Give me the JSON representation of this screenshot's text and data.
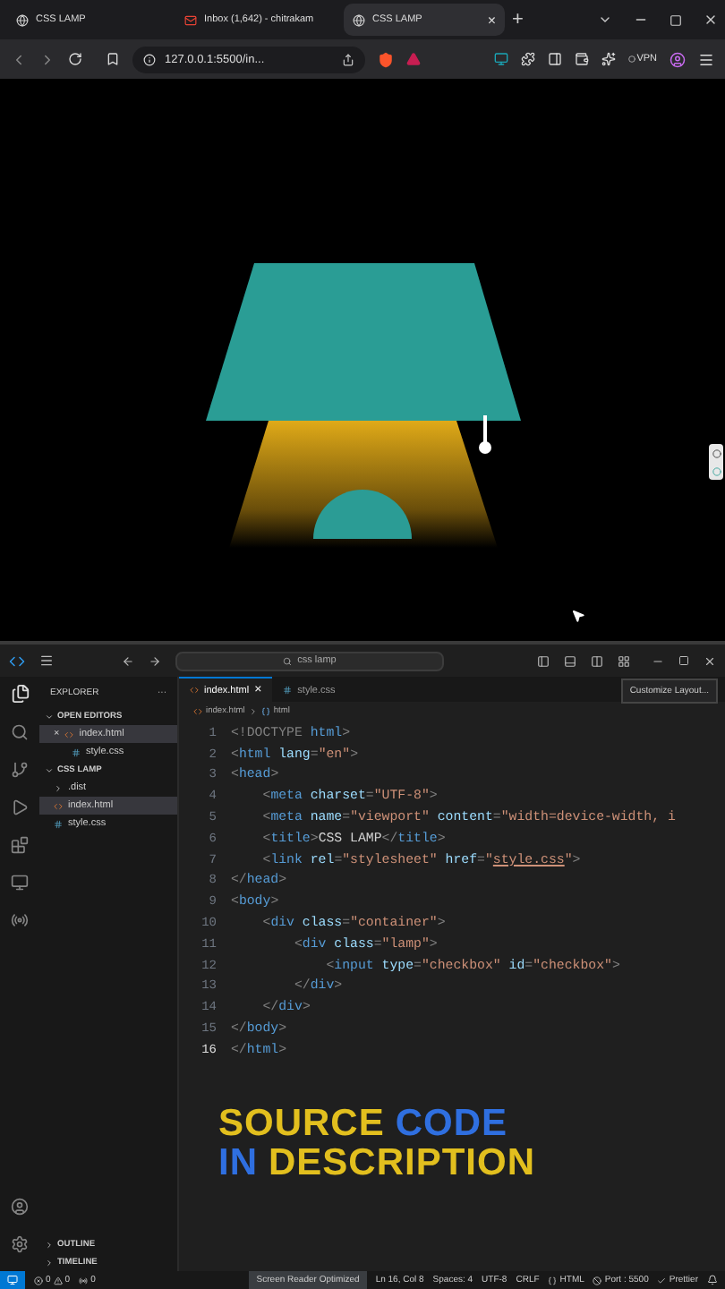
{
  "browser": {
    "tabs": [
      {
        "title": "CSS LAMP",
        "kind": "globe",
        "selected": false
      },
      {
        "title": "Inbox (1,642) - chitrakam",
        "kind": "mail",
        "selected": false
      },
      {
        "title": "CSS LAMP",
        "kind": "globe",
        "selected": true,
        "close": "×"
      }
    ],
    "new_tab": "+",
    "url": "127.0.0.1:5500/in...",
    "vpn": "VPN"
  },
  "page": {
    "lamp": {
      "on": true
    }
  },
  "editor": {
    "search": "css lamp",
    "tooltip": "Customize Layout...",
    "explorer": {
      "title": "EXPLORER",
      "more": "···",
      "sections": [
        {
          "title": "OPEN EDITORS",
          "expanded": true,
          "items": [
            {
              "name": "index.html",
              "kind": "html",
              "selected": true,
              "close": "×"
            },
            {
              "name": "style.css",
              "kind": "css",
              "selected": false
            }
          ]
        },
        {
          "title": "CSS LAMP",
          "expanded": true,
          "items": [
            {
              "name": ".dist",
              "kind": "folder",
              "selected": false
            },
            {
              "name": "index.html",
              "kind": "html",
              "selected": true
            },
            {
              "name": "style.css",
              "kind": "css",
              "selected": false
            }
          ]
        }
      ],
      "bottom_sections": [
        {
          "title": "OUTLINE",
          "expanded": false
        },
        {
          "title": "TIMELINE",
          "expanded": false
        }
      ]
    },
    "tabs": [
      {
        "name": "index.html",
        "kind": "html",
        "selected": true,
        "close": "×"
      },
      {
        "name": "style.css",
        "kind": "css",
        "selected": false
      }
    ],
    "breadcrumb": [
      "index.html",
      "html"
    ],
    "lines": [
      {
        "number": "1",
        "current": false,
        "tokens": [
          {
            "kind": "p",
            "t": "<!DOCTYPE"
          },
          {
            "kind": "tag",
            "t": " html"
          },
          {
            "kind": "p",
            "t": ">"
          }
        ]
      },
      {
        "number": "2",
        "current": false,
        "tokens": [
          {
            "kind": "p",
            "t": "<"
          },
          {
            "kind": "tag",
            "t": "html"
          },
          {
            "kind": "attr",
            "t": " lang"
          },
          {
            "kind": "p",
            "t": "="
          },
          {
            "kind": "str",
            "t": "\"en\""
          },
          {
            "kind": "p",
            "t": ">"
          }
        ]
      },
      {
        "number": "3",
        "current": false,
        "tokens": [
          {
            "kind": "p",
            "t": "<"
          },
          {
            "kind": "tag",
            "t": "head"
          },
          {
            "kind": "p",
            "t": ">"
          }
        ]
      },
      {
        "number": "4",
        "current": false,
        "tokens": [
          {
            "kind": "p",
            "t": "    <"
          },
          {
            "kind": "tag",
            "t": "meta"
          },
          {
            "kind": "attr",
            "t": " charset"
          },
          {
            "kind": "p",
            "t": "="
          },
          {
            "kind": "str",
            "t": "\"UTF-8\""
          },
          {
            "kind": "p",
            "t": ">"
          }
        ]
      },
      {
        "number": "5",
        "current": false,
        "tokens": [
          {
            "kind": "p",
            "t": "    <"
          },
          {
            "kind": "tag",
            "t": "meta"
          },
          {
            "kind": "attr",
            "t": " name"
          },
          {
            "kind": "p",
            "t": "="
          },
          {
            "kind": "str",
            "t": "\"viewport\""
          },
          {
            "kind": "attr",
            "t": " content"
          },
          {
            "kind": "p",
            "t": "="
          },
          {
            "kind": "str",
            "t": "\"width=device-width, i"
          }
        ]
      },
      {
        "number": "6",
        "current": false,
        "tokens": [
          {
            "kind": "p",
            "t": "    <"
          },
          {
            "kind": "tag",
            "t": "title"
          },
          {
            "kind": "p",
            "t": ">"
          },
          {
            "kind": "text",
            "t": "CSS LAMP"
          },
          {
            "kind": "p",
            "t": "</"
          },
          {
            "kind": "tag",
            "t": "title"
          },
          {
            "kind": "p",
            "t": ">"
          }
        ]
      },
      {
        "number": "7",
        "current": false,
        "tokens": [
          {
            "kind": "p",
            "t": "    <"
          },
          {
            "kind": "tag",
            "t": "link"
          },
          {
            "kind": "attr",
            "t": " rel"
          },
          {
            "kind": "p",
            "t": "="
          },
          {
            "kind": "str",
            "t": "\"stylesheet\""
          },
          {
            "kind": "attr",
            "t": " href"
          },
          {
            "kind": "p",
            "t": "="
          },
          {
            "kind": "str",
            "t": "\""
          },
          {
            "kind": "link",
            "t": "style.css"
          },
          {
            "kind": "str",
            "t": "\""
          },
          {
            "kind": "p",
            "t": ">"
          }
        ]
      },
      {
        "number": "8",
        "current": false,
        "tokens": [
          {
            "kind": "p",
            "t": "</"
          },
          {
            "kind": "tag",
            "t": "head"
          },
          {
            "kind": "p",
            "t": ">"
          }
        ]
      },
      {
        "number": "9",
        "current": false,
        "tokens": [
          {
            "kind": "p",
            "t": "<"
          },
          {
            "kind": "tag",
            "t": "body"
          },
          {
            "kind": "p",
            "t": ">"
          }
        ]
      },
      {
        "number": "10",
        "current": false,
        "tokens": [
          {
            "kind": "p",
            "t": "    <"
          },
          {
            "kind": "tag",
            "t": "div"
          },
          {
            "kind": "attr",
            "t": " class"
          },
          {
            "kind": "p",
            "t": "="
          },
          {
            "kind": "str",
            "t": "\"container\""
          },
          {
            "kind": "p",
            "t": ">"
          }
        ]
      },
      {
        "number": "11",
        "current": false,
        "tokens": [
          {
            "kind": "p",
            "t": "        <"
          },
          {
            "kind": "tag",
            "t": "div"
          },
          {
            "kind": "attr",
            "t": " class"
          },
          {
            "kind": "p",
            "t": "="
          },
          {
            "kind": "str",
            "t": "\"lamp\""
          },
          {
            "kind": "p",
            "t": ">"
          }
        ]
      },
      {
        "number": "12",
        "current": false,
        "tokens": [
          {
            "kind": "p",
            "t": "            <"
          },
          {
            "kind": "tag",
            "t": "input"
          },
          {
            "kind": "attr",
            "t": " type"
          },
          {
            "kind": "p",
            "t": "="
          },
          {
            "kind": "str",
            "t": "\"checkbox\""
          },
          {
            "kind": "attr",
            "t": " id"
          },
          {
            "kind": "p",
            "t": "="
          },
          {
            "kind": "str",
            "t": "\"checkbox\""
          },
          {
            "kind": "p",
            "t": ">"
          }
        ]
      },
      {
        "number": "13",
        "current": false,
        "tokens": [
          {
            "kind": "p",
            "t": "        </"
          },
          {
            "kind": "tag",
            "t": "div"
          },
          {
            "kind": "p",
            "t": ">"
          }
        ]
      },
      {
        "number": "14",
        "current": false,
        "tokens": [
          {
            "kind": "p",
            "t": "    </"
          },
          {
            "kind": "tag",
            "t": "div"
          },
          {
            "kind": "p",
            "t": ">"
          }
        ]
      },
      {
        "number": "15",
        "current": false,
        "tokens": [
          {
            "kind": "p",
            "t": "</"
          },
          {
            "kind": "tag",
            "t": "body"
          },
          {
            "kind": "p",
            "t": ">"
          }
        ]
      },
      {
        "number": "16",
        "current": true,
        "tokens": [
          {
            "kind": "p",
            "t": "</"
          },
          {
            "kind": "tag",
            "t": "html"
          },
          {
            "kind": "p",
            "t": ">"
          }
        ]
      }
    ],
    "overlay": [
      [
        {
          "text": "SOURCE",
          "color": "#e2bf1e"
        },
        {
          "text": "CODE",
          "color": "#2f6fe0"
        }
      ],
      [
        {
          "text": "IN",
          "color": "#2f6fe0"
        },
        {
          "text": "DESCRIPTION",
          "color": "#e2bf1e"
        }
      ]
    ],
    "status": [
      {
        "kind": "remote"
      },
      {
        "kind": "problems",
        "errors": "0",
        "warnings": "0"
      },
      {
        "kind": "ports",
        "text": "0"
      },
      {
        "kind": "highlight",
        "text": "Screen Reader Optimized"
      },
      {
        "kind": "plain",
        "text": "Ln 16, Col 8"
      },
      {
        "kind": "plain",
        "text": "Spaces: 4"
      },
      {
        "kind": "plain",
        "text": "UTF-8"
      },
      {
        "kind": "plain",
        "text": "CRLF"
      },
      {
        "kind": "language",
        "text": "HTML"
      },
      {
        "kind": "port",
        "text": "Port : 5500"
      },
      {
        "kind": "check",
        "text": "Prettier"
      },
      {
        "kind": "bell"
      }
    ]
  }
}
